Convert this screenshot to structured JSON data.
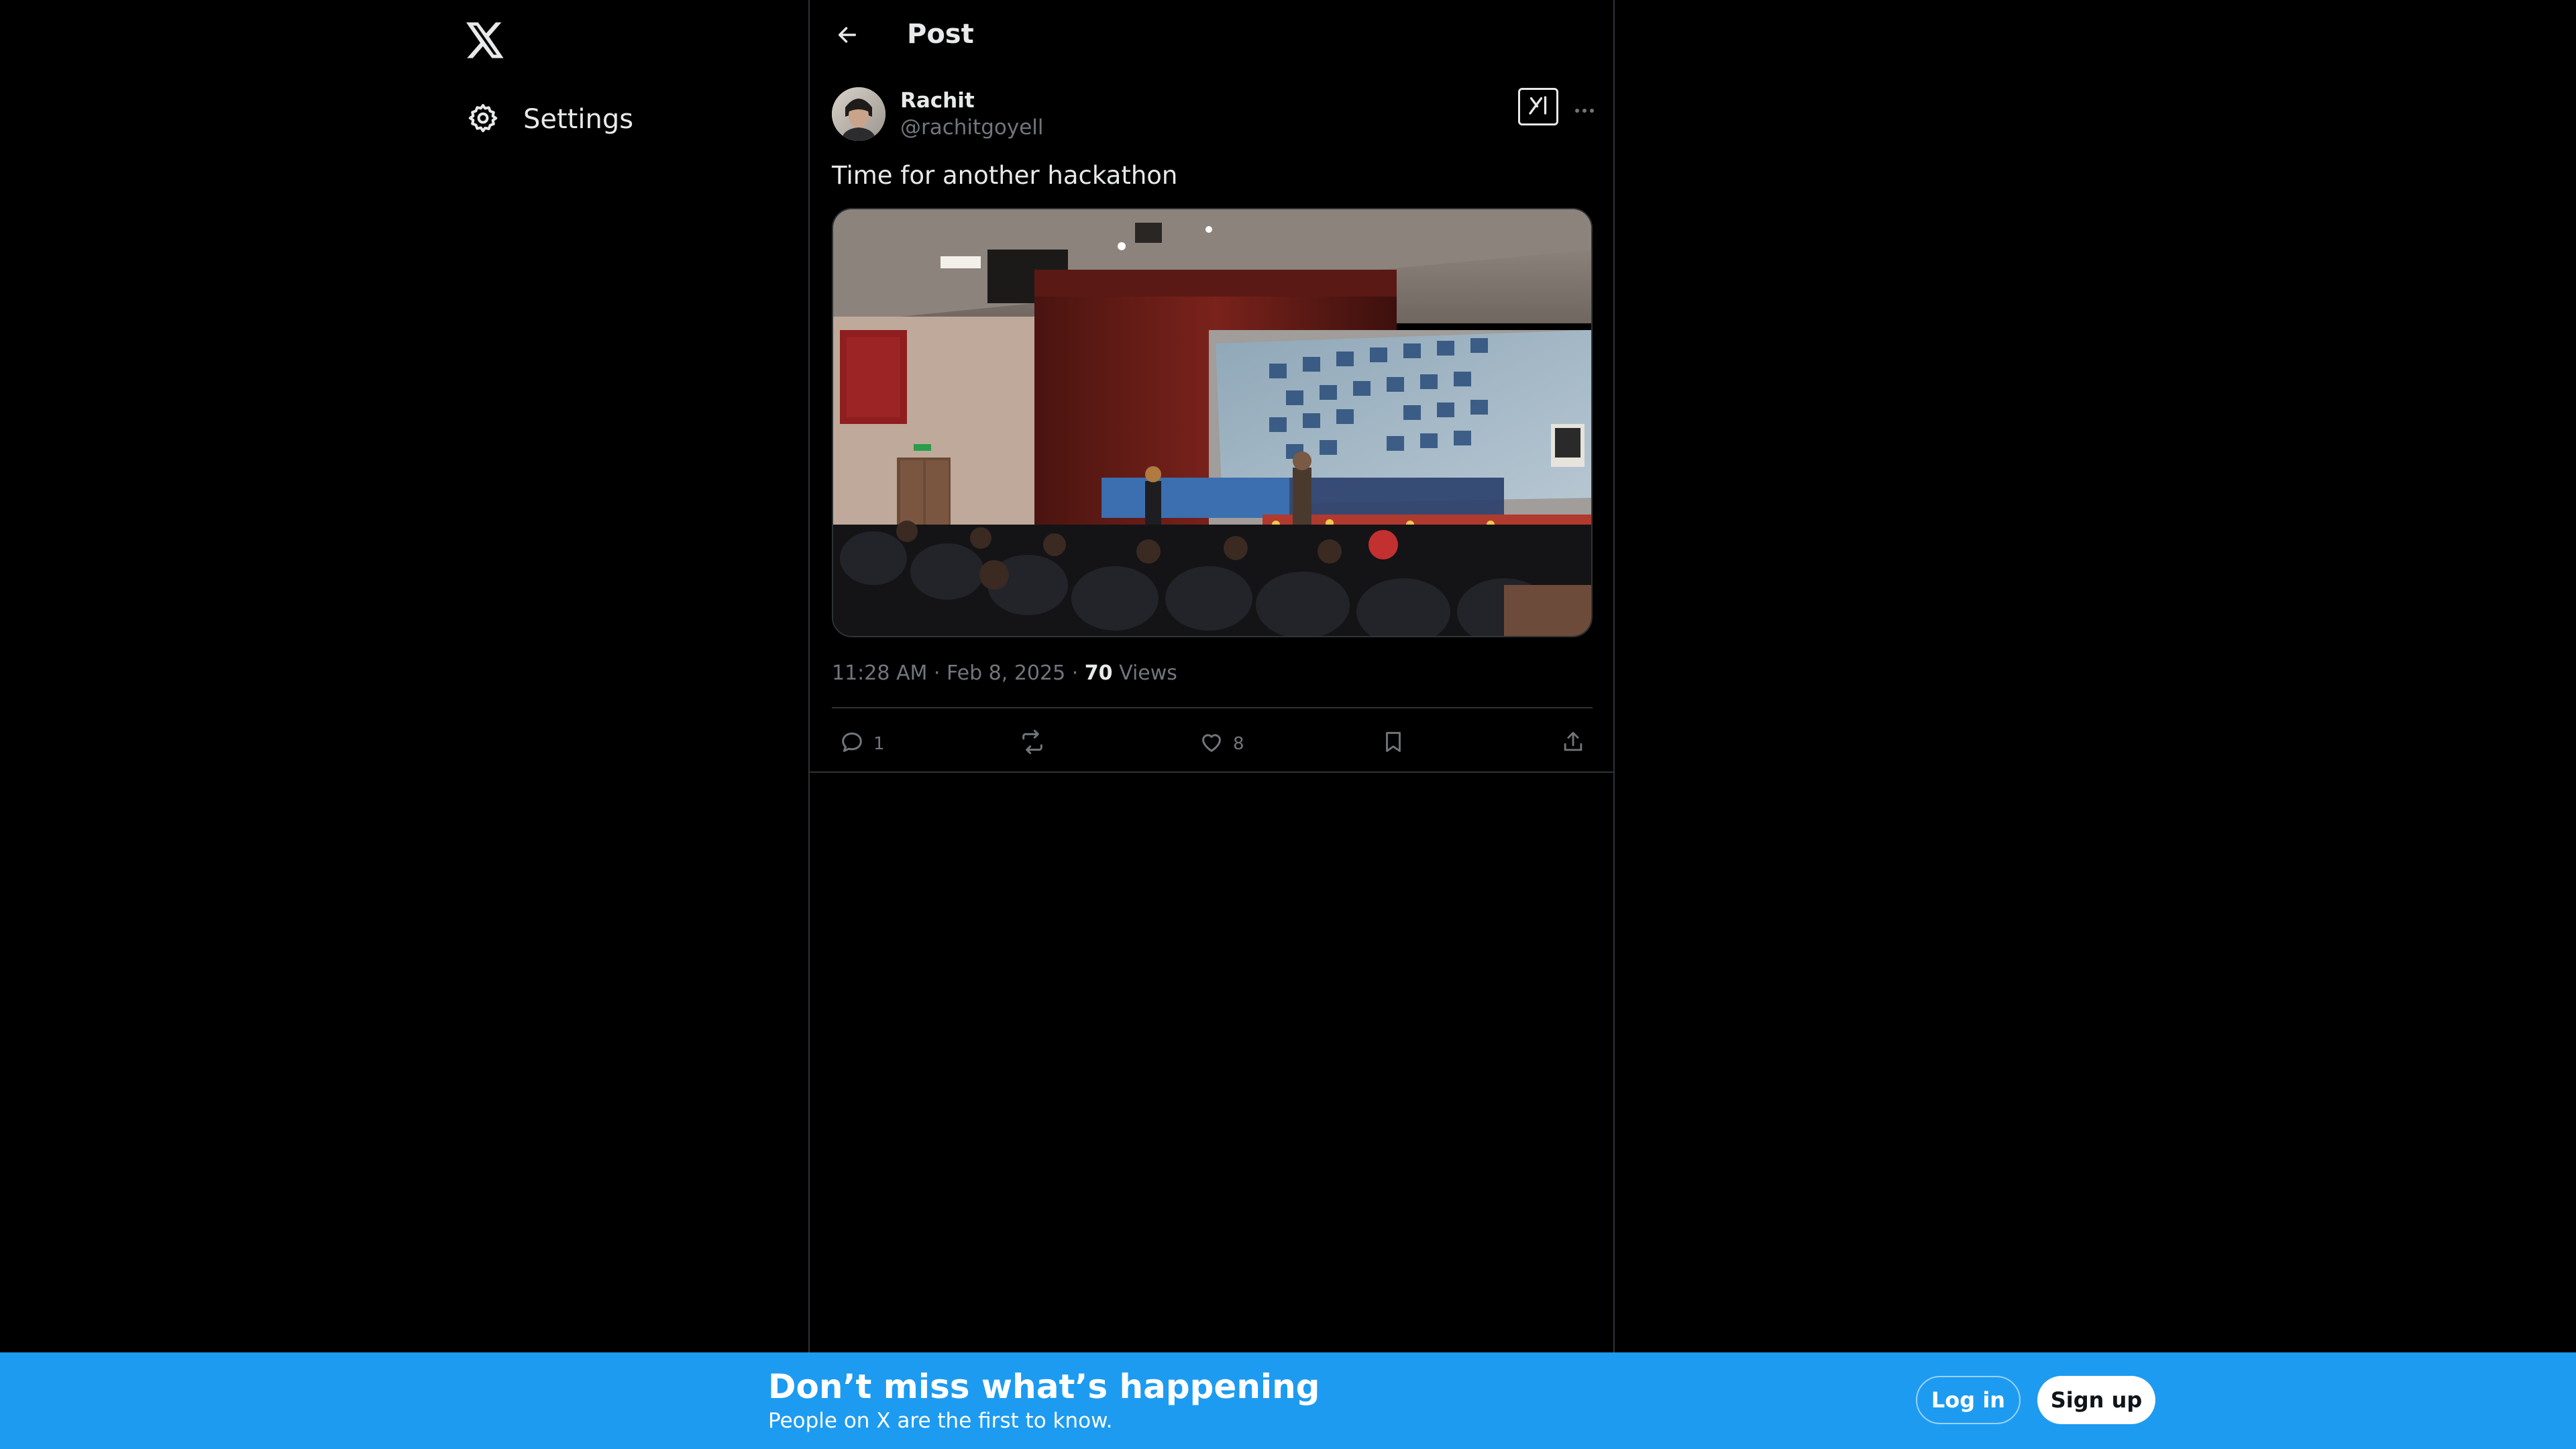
{
  "brand": {
    "logo_icon": "x-logo-icon"
  },
  "sidebar": {
    "items": [
      {
        "label": "Settings",
        "icon": "gear-icon"
      }
    ]
  },
  "header": {
    "title": "Post",
    "back_icon": "arrow-left-icon"
  },
  "post": {
    "author_name": "Rachit",
    "author_handle": "@rachitgoyell",
    "text": "Time for another hackathon",
    "timestamp": "11:28 AM · Feb 8, 2025 · ",
    "views_count": "70",
    "views_label": "Views",
    "media_description_icon": "hackathon-auditorium-photo",
    "actions": {
      "reply_count": "1",
      "retweet_count": "",
      "like_count": "8"
    }
  },
  "banner": {
    "title": "Don’t miss what’s happening",
    "subtitle": "People on X are the first to know.",
    "login_label": "Log in",
    "signup_label": "Sign up"
  },
  "colors": {
    "background": "#000000",
    "text_primary": "#e7e9ea",
    "text_secondary": "#71767b",
    "border": "#2f3336",
    "accent": "#1d9bf0"
  }
}
